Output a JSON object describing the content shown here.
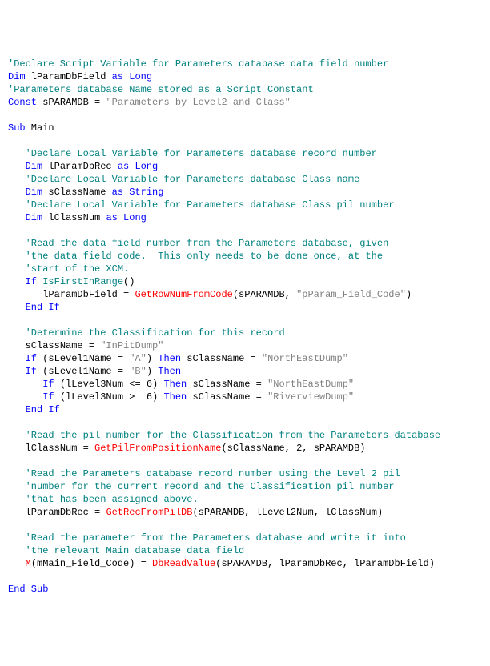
{
  "code": {
    "c1": "'Declare Script Variable for Parameters database data field number",
    "l2_k1": "Dim",
    "l2_id": " lParamDbField ",
    "l2_k2": "as Long",
    "c3": "'Parameters database Name stored as a Script Constant",
    "l4_k": "Const",
    "l4_id": " sPARAMDB = ",
    "l4_s": "\"Parameters by Level2 and Class\"",
    "l6_k": "Sub",
    "l6_id": " Main",
    "c8": "'Declare Local Variable for Parameters database record number",
    "l9_k1": "Dim",
    "l9_id": " lParamDbRec ",
    "l9_k2": "as Long",
    "c10": "'Declare Local Variable for Parameters database Class name",
    "l11_k1": "Dim",
    "l11_id": " sClassName ",
    "l11_k2": "as String",
    "c12": "'Declare Local Variable for Parameters database Class pil number",
    "l13_k1": "Dim",
    "l13_id": " lClassNum ",
    "l13_k2": "as Long",
    "c15": "'Read the data field number from the Parameters database, given",
    "c16": "'the data field code.  This only needs to be done once, at the",
    "c17": "'start of the XCM.",
    "l18_k": "If",
    "l18_fn": " IsFirstInRange",
    "l18_rest": "()",
    "l19_id1": "lParamDbField = ",
    "l19_fn": "GetRowNumFromCode",
    "l19_p1": "(sPARAMDB, ",
    "l19_s": "\"pParam_Field_Code\"",
    "l19_p2": ")",
    "l20_k": "End If",
    "c22": "'Determine the Classification for this record",
    "l23_id": "sClassName = ",
    "l23_s": "\"InPitDump\"",
    "l24_k1": "If",
    "l24_p1": " (sLevel1Name = ",
    "l24_s1": "\"A\"",
    "l24_p2": ") ",
    "l24_k2": "Then",
    "l24_p3": " sClassName = ",
    "l24_s2": "\"NorthEastDump\"",
    "l25_k1": "If",
    "l25_p1": " (sLevel1Name = ",
    "l25_s1": "\"B\"",
    "l25_p2": ") ",
    "l25_k2": "Then",
    "l26_k1": "If",
    "l26_p1": " (lLevel3Num <= 6) ",
    "l26_k2": "Then",
    "l26_p2": " sClassName = ",
    "l26_s": "\"NorthEastDump\"",
    "l27_k1": "If",
    "l27_p1": " (lLevel3Num >  6) ",
    "l27_k2": "Then",
    "l27_p2": " sClassName = ",
    "l27_s": "\"RiverviewDump\"",
    "l28_k": "End If",
    "c30": "'Read the pil number for the Classification from the Parameters database",
    "l31_id": "lClassNum = ",
    "l31_fn": "GetPilFromPositionName",
    "l31_p": "(sClassName, 2, sPARAMDB)",
    "c33": "'Read the Parameters database record number using the Level 2 pil",
    "c34": "'number for the current record and the Classification pil number",
    "c35": "'that has been assigned above.",
    "l36_id": "lParamDbRec = ",
    "l36_fn": "GetRecFromPilDB",
    "l36_p": "(sPARAMDB, lLevel2Num, lClassNum)",
    "c38": "'Read the parameter from the Parameters database and write it into",
    "c39": "'the relevant Main database data field",
    "l40_fn1": "M",
    "l40_p1": "(mMain_Field_Code) = ",
    "l40_fn2": "DbReadValue",
    "l40_p2": "(sPARAMDB, lParamDbRec, lParamDbField)",
    "l42_k": "End Sub"
  }
}
